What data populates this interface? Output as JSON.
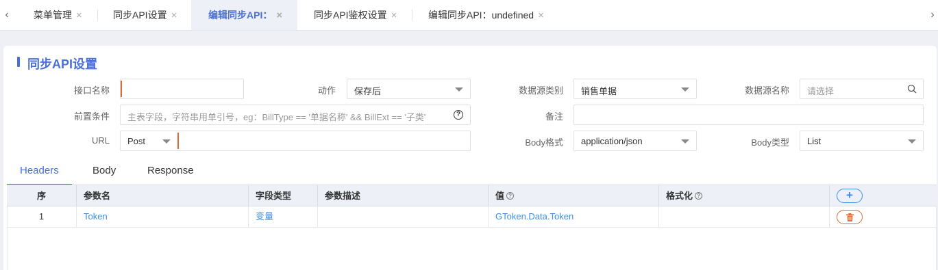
{
  "tabs": [
    {
      "label": "菜单管理",
      "close": "×"
    },
    {
      "label": "同步API设置",
      "close": "×"
    },
    {
      "label": "编辑同步API：",
      "close": "×",
      "active": true
    },
    {
      "label": "同步API鉴权设置",
      "close": "×"
    },
    {
      "label": "编辑同步API：undefined",
      "close": "×"
    }
  ],
  "nav": {
    "prev": "‹",
    "next": "›"
  },
  "page_title": "同步API设置",
  "form": {
    "api_name": {
      "label": "接口名称",
      "value": ""
    },
    "action": {
      "label": "动作",
      "value": "保存后"
    },
    "datasource_type": {
      "label": "数据源类别",
      "value": "销售单据"
    },
    "datasource_name": {
      "label": "数据源名称",
      "placeholder": "请选择"
    },
    "precondition": {
      "label": "前置条件",
      "placeholder": "主表字段，字符串用单引号，eg：BillType == '单据名称' && BillExt == '子类'"
    },
    "remark": {
      "label": "备注",
      "value": ""
    },
    "url": {
      "label": "URL",
      "method": "Post",
      "value": ""
    },
    "body_format": {
      "label": "Body格式",
      "value": "application/json"
    },
    "body_type": {
      "label": "Body类型",
      "value": "List"
    }
  },
  "subtabs": [
    "Headers",
    "Body",
    "Response"
  ],
  "table": {
    "headers": [
      "序",
      "参数名",
      "字段类型",
      "参数描述",
      "值",
      "格式化"
    ],
    "add_label": "+",
    "rows": [
      {
        "index": "1",
        "name": "Token",
        "type": "变量",
        "desc": "",
        "value": "GToken.Data.Token",
        "format": ""
      }
    ]
  },
  "colors": {
    "accent": "#4a6fd6",
    "link": "#3a8ee6",
    "danger": "#e06a35"
  }
}
